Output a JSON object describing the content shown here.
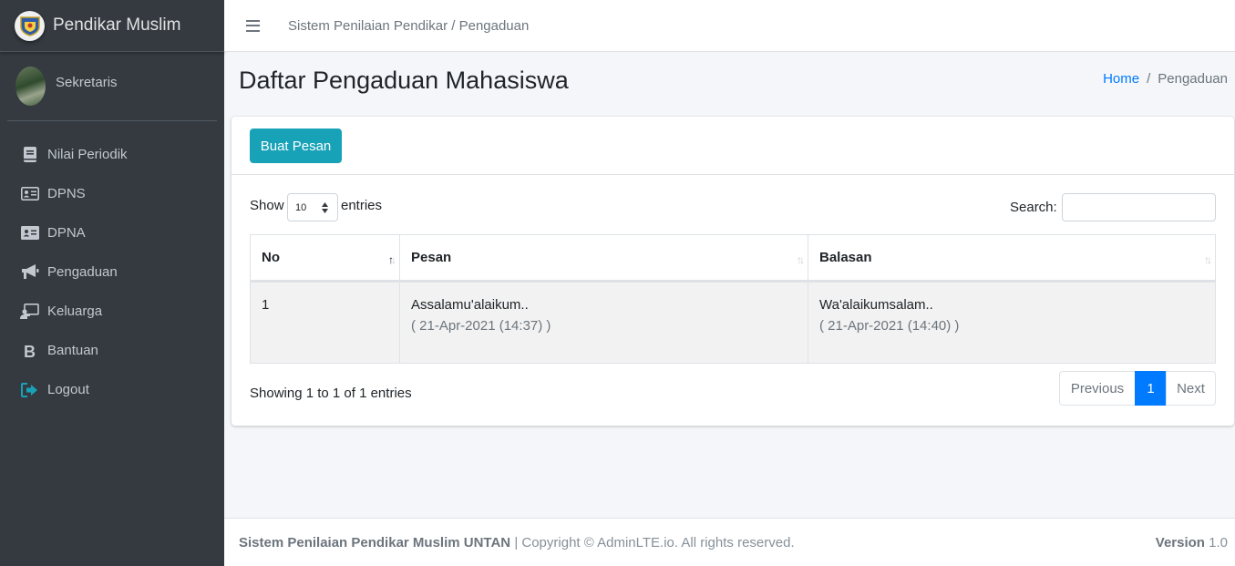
{
  "brand": {
    "name": "Pendikar Muslim",
    "logo_icon": "university-seal-icon"
  },
  "user": {
    "name": "Sekretaris"
  },
  "sidebar": {
    "items": [
      {
        "label": "Nilai Periodik",
        "icon": "book-icon"
      },
      {
        "label": "DPNS",
        "icon": "id-card-icon"
      },
      {
        "label": "DPNA",
        "icon": "id-card-icon"
      },
      {
        "label": "Pengaduan",
        "icon": "bullhorn-icon"
      },
      {
        "label": "Keluarga",
        "icon": "chalkboard-teacher-icon"
      },
      {
        "label": "Bantuan",
        "icon": "bold-b-icon"
      },
      {
        "label": "Logout",
        "icon": "sign-out-icon"
      }
    ]
  },
  "topbar": {
    "breadcrumb": "Sistem Penilaian Pendikar / Pengaduan"
  },
  "header": {
    "title": "Daftar Pengaduan Mahasiswa",
    "breadcrumb": {
      "home": "Home",
      "separator": "/",
      "current": "Pengaduan"
    }
  },
  "card": {
    "button_label": "Buat Pesan",
    "show_label": "Show",
    "entries_select": "10",
    "entries_label": "entries",
    "search_label": "Search:",
    "search_value": "",
    "table": {
      "headers": [
        "No",
        "Pesan",
        "Balasan"
      ],
      "rows": [
        {
          "no": "1",
          "pesan": "Assalamu'alaikum..",
          "pesan_time": "( 21-Apr-2021 (14:37) )",
          "balasan": "Wa'alaikumsalam..",
          "balasan_time": "( 21-Apr-2021 (14:40) )"
        }
      ]
    },
    "info": "Showing 1 to 1 of 1 entries",
    "pagination": {
      "previous": "Previous",
      "current": "1",
      "next": "Next"
    }
  },
  "footer": {
    "app_name": "Sistem Penilaian Pendikar Muslim UNTAN",
    "copyright": "| Copyright © AdminLTE.io. All rights reserved.",
    "version_label": "Version",
    "version": "1.0"
  },
  "colors": {
    "sidebar": "#343a40",
    "primary": "#007bff",
    "info": "#17a2b8",
    "logout_icon": "#17a2b8"
  }
}
